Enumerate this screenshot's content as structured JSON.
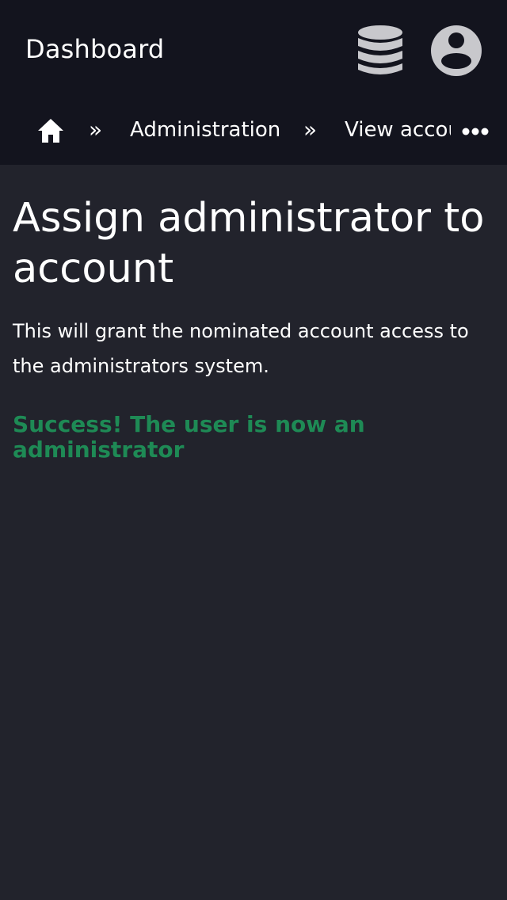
{
  "header": {
    "title": "Dashboard"
  },
  "icons": {
    "database": "database-icon",
    "account": "user-circle-icon",
    "home": "home-icon",
    "more": "more-horizontal-icon"
  },
  "breadcrumb": {
    "separator": "»",
    "items": [
      {
        "label": "Administration"
      },
      {
        "label": "View account"
      }
    ]
  },
  "main": {
    "title": "Assign administrator to account",
    "description": "This will grant the nominated account access to the administrators system.",
    "success_message": "Success! The user is now an administrator"
  },
  "colors": {
    "header_background": "#13141e",
    "page_background": "#22232c",
    "success": "#1e8a55",
    "icon_fill": "#c8c8cc"
  }
}
